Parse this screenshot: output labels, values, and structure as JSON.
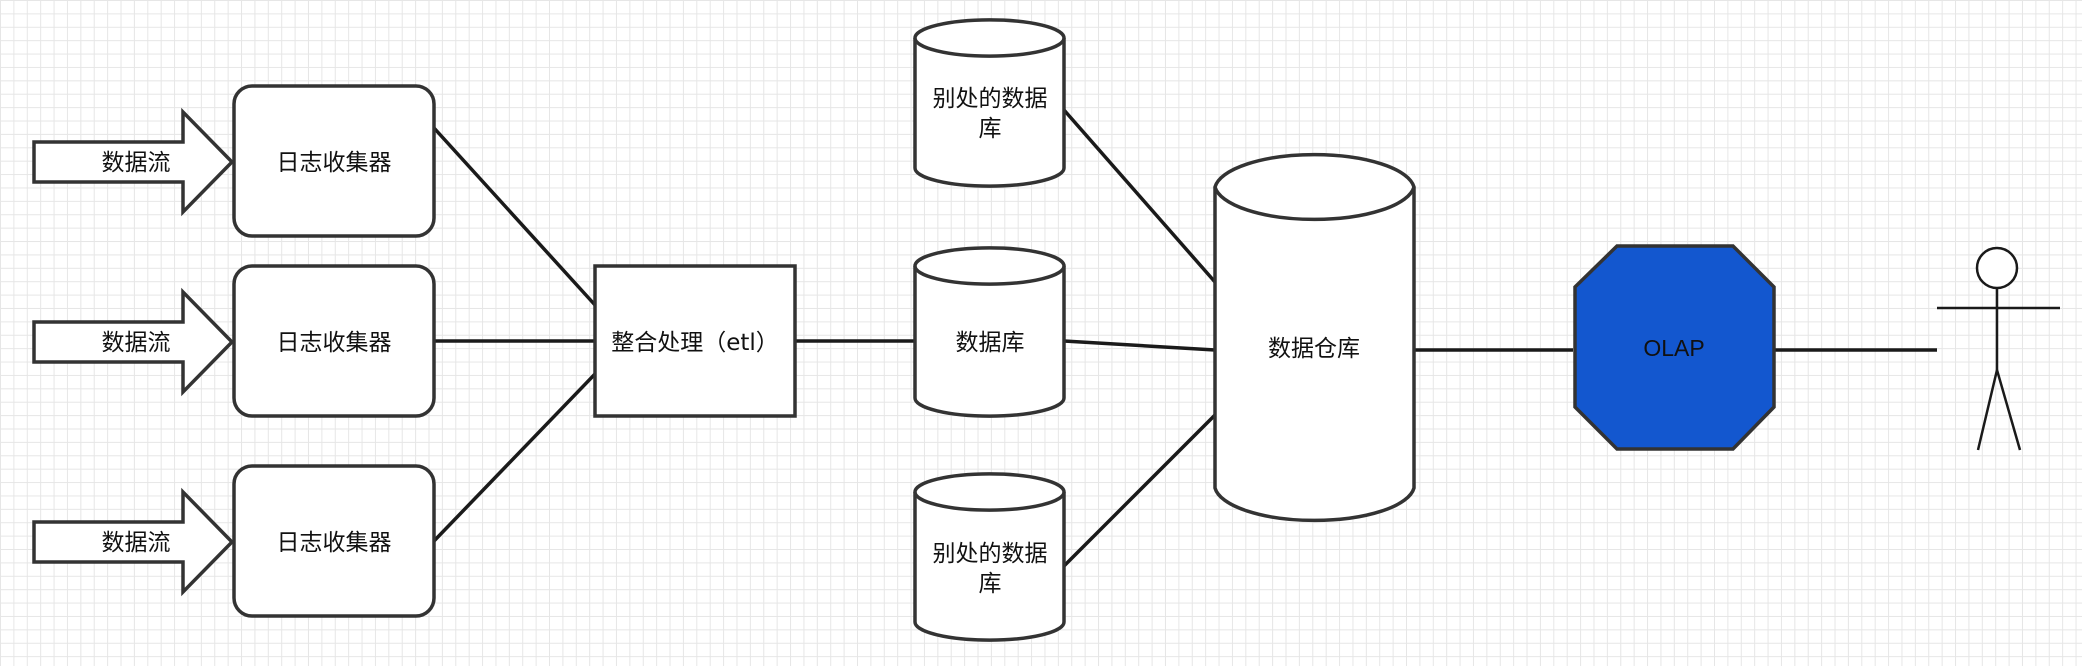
{
  "diagram": {
    "streams": [
      "数据流",
      "数据流",
      "数据流"
    ],
    "collectors": [
      "日志收集器",
      "日志收集器",
      "日志收集器"
    ],
    "etl": "整合处理（etl）",
    "databases": [
      {
        "line1": "别处的数据",
        "line2": "库"
      },
      {
        "line1": "数据库",
        "line2": ""
      },
      {
        "line1": "别处的数据",
        "line2": "库"
      }
    ],
    "warehouse": "数据仓库",
    "olap": "OLAP",
    "colors": {
      "olap_fill": "#1357cf",
      "stroke": "#333333",
      "grid": "#e6e6e6"
    }
  }
}
